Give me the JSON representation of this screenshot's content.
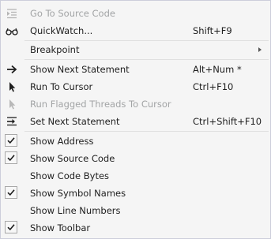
{
  "menu": {
    "go_to_source": {
      "label": "Go To Source Code",
      "icon": "source-list-icon"
    },
    "quickwatch": {
      "label": "QuickWatch...",
      "shortcut": "Shift+F9",
      "icon": "glasses-icon"
    },
    "breakpoint": {
      "label": "Breakpoint"
    },
    "show_next_statement": {
      "label": "Show Next Statement",
      "shortcut": "Alt+Num *",
      "icon": "arrow-right-icon"
    },
    "run_to_cursor": {
      "label": "Run To Cursor",
      "shortcut": "Ctrl+F10",
      "icon": "cursor-icon"
    },
    "run_flagged_threads": {
      "label": "Run Flagged Threads To Cursor",
      "icon": "cursor-icon"
    },
    "set_next_statement": {
      "label": "Set Next Statement",
      "shortcut": "Ctrl+Shift+F10",
      "icon": "set-next-statement-icon"
    },
    "show_address": {
      "label": "Show Address",
      "checked": true
    },
    "show_source_code": {
      "label": "Show Source Code",
      "checked": true
    },
    "show_code_bytes": {
      "label": "Show Code Bytes",
      "checked": false
    },
    "show_symbol_names": {
      "label": "Show Symbol Names",
      "checked": true
    },
    "show_line_numbers": {
      "label": "Show Line Numbers",
      "checked": false
    },
    "show_toolbar": {
      "label": "Show Toolbar",
      "checked": true
    }
  },
  "colors": {
    "text": "#1e1e1e",
    "disabled": "#a2a4a5",
    "background": "#f5f5f5",
    "separator": "#e0e0e0"
  }
}
